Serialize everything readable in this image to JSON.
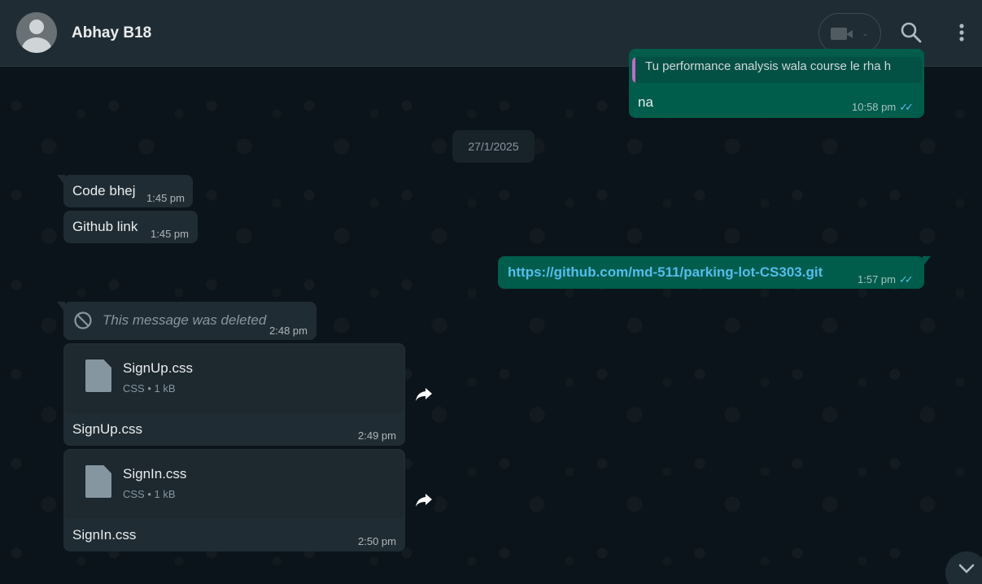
{
  "header": {
    "contact_name": "Abhay B18",
    "avatar_icon": "default-avatar-icon",
    "video_icon": "video-camera-icon",
    "search_icon": "search-icon",
    "menu_icon": "kebab-menu-icon"
  },
  "messages": {
    "prev_quote": "Tu performance analysis wala course le rha h",
    "prev_text": "na",
    "prev_time": "10:58 pm",
    "date_chip": "27/1/2025",
    "m1_text": "Code bhej",
    "m1_time": "1:45 pm",
    "m2_text": "Github link",
    "m2_time": "1:45 pm",
    "m3_link": "https://github.com/md-511/parking-lot-CS303.git",
    "m3_time": "1:57 pm",
    "m4_text": "This message was deleted",
    "m4_time": "2:48 pm",
    "file1": {
      "name": "SignUp.css",
      "meta": "CSS • 1 kB",
      "caption": "SignUp.css",
      "time": "2:49 pm"
    },
    "file2": {
      "name": "SignIn.css",
      "meta": "CSS • 1 kB",
      "caption": "SignIn.css",
      "time": "2:50 pm"
    }
  },
  "colors": {
    "background": "#0b141a",
    "header": "#202c33",
    "incoming_bubble": "#202c33",
    "outgoing_bubble": "#005c4b",
    "link": "#53bdeb",
    "read_ticks": "#53bdeb"
  }
}
